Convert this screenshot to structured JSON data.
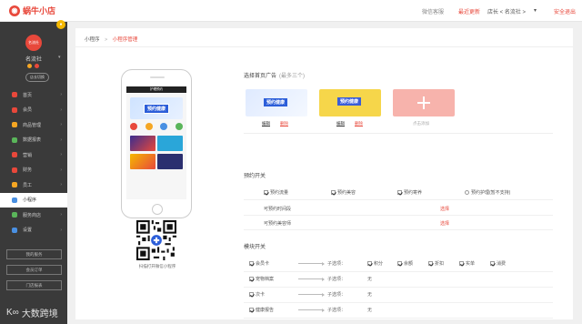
{
  "header": {
    "brand": "蜗牛小店",
    "wechat_link": "微信客服",
    "update_link": "最近更新",
    "role": "店长 < 名流社 >",
    "caret": "▾",
    "logout": "安全退出"
  },
  "sidebar": {
    "badge": "●",
    "avatar_text": "名流社",
    "user": "名流社",
    "pill": "店长切换",
    "items": [
      {
        "label": "首页",
        "color": "#e8483b"
      },
      {
        "label": "会员",
        "color": "#e8483b"
      },
      {
        "label": "商品管理",
        "color": "#f5a623"
      },
      {
        "label": "数据报表",
        "color": "#5ab55a"
      },
      {
        "label": "营销",
        "color": "#e8483b"
      },
      {
        "label": "财务",
        "color": "#e8483b"
      },
      {
        "label": "员工",
        "color": "#f5a623"
      },
      {
        "label": "小程序",
        "color": "#4a90e2"
      },
      {
        "label": "服务商店",
        "color": "#5ab55a"
      },
      {
        "label": "设置",
        "color": "#4a90e2"
      }
    ],
    "actions": [
      "我的服务",
      "会员订单",
      "门店报表"
    ]
  },
  "breadcrumb": {
    "root": "小程序",
    "separator": ">",
    "current": "小程序管理"
  },
  "preview": {
    "nav_title": "护理预约",
    "banner_text": "预约健康",
    "qr_label": "扫描打开微信小程序"
  },
  "ads": {
    "title": "选择首页广告",
    "hint": "(最多三个)",
    "edit": "编辑",
    "delete": "删除",
    "add_label": "点击添加"
  },
  "booking": {
    "title": "预约开关",
    "options": [
      {
        "label": "预约流量",
        "checked": true
      },
      {
        "label": "预约美容",
        "checked": true
      },
      {
        "label": "预约寄养",
        "checked": true
      },
      {
        "label": "预约护理(暂不支持)",
        "checked": false
      }
    ],
    "rows": [
      {
        "label": "可预约时间段",
        "action": "选择"
      },
      {
        "label": "可预约美容师",
        "action": "选择"
      }
    ]
  },
  "modules": {
    "title": "模块开关",
    "sub_label": "子选项：",
    "none": "无",
    "rows": [
      {
        "label": "会员卡",
        "checked": true,
        "subs": [
          {
            "label": "积分",
            "checked": true
          },
          {
            "label": "余额",
            "checked": true
          },
          {
            "label": "折扣",
            "checked": true
          },
          {
            "label": "实单",
            "checked": true
          },
          {
            "label": "消费",
            "checked": true
          }
        ]
      },
      {
        "label": "宠物档案",
        "checked": true,
        "subs": []
      },
      {
        "label": "次卡",
        "checked": true,
        "subs": []
      },
      {
        "label": "健康报告",
        "checked": true,
        "subs": []
      }
    ]
  },
  "watermark": "大数跨境"
}
